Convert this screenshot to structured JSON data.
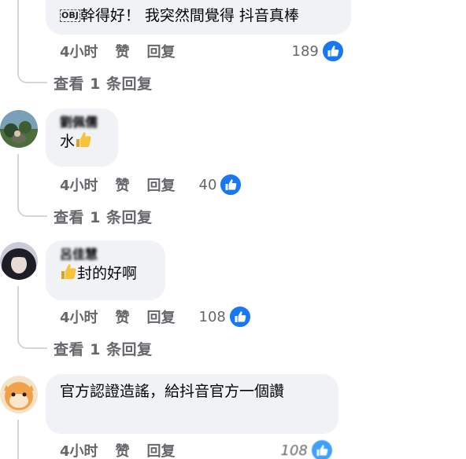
{
  "colors": {
    "accent": "#1877f2",
    "bubble": "#f0f2f5",
    "muted": "#65676b"
  },
  "comments": [
    {
      "author": "",
      "text_prefix": "OBJ",
      "text": "幹得好！ 我突然間覺得 抖音真棒",
      "time": "4小时",
      "like": "赞",
      "reply": "回复",
      "reactions": "189",
      "view_replies": "查看 1 条回复"
    },
    {
      "author": "劉佩儒",
      "text": "水",
      "text_suffix_icon": "thumbs-up-emoji",
      "time": "4小时",
      "like": "赞",
      "reply": "回复",
      "reactions": "40",
      "view_replies": "查看 1 条回复"
    },
    {
      "author": "呂佳慧",
      "text_prefix_icon": "thumbs-up-emoji",
      "text": "封的好啊",
      "time": "4小时",
      "like": "赞",
      "reply": "回复",
      "reactions": "108",
      "view_replies": "查看 1 条回复"
    },
    {
      "author": "",
      "text": "官方認證造謠，給抖音官方一個讚",
      "time": "4小时",
      "like": "赞",
      "reply": "回复",
      "reactions": "108"
    }
  ]
}
